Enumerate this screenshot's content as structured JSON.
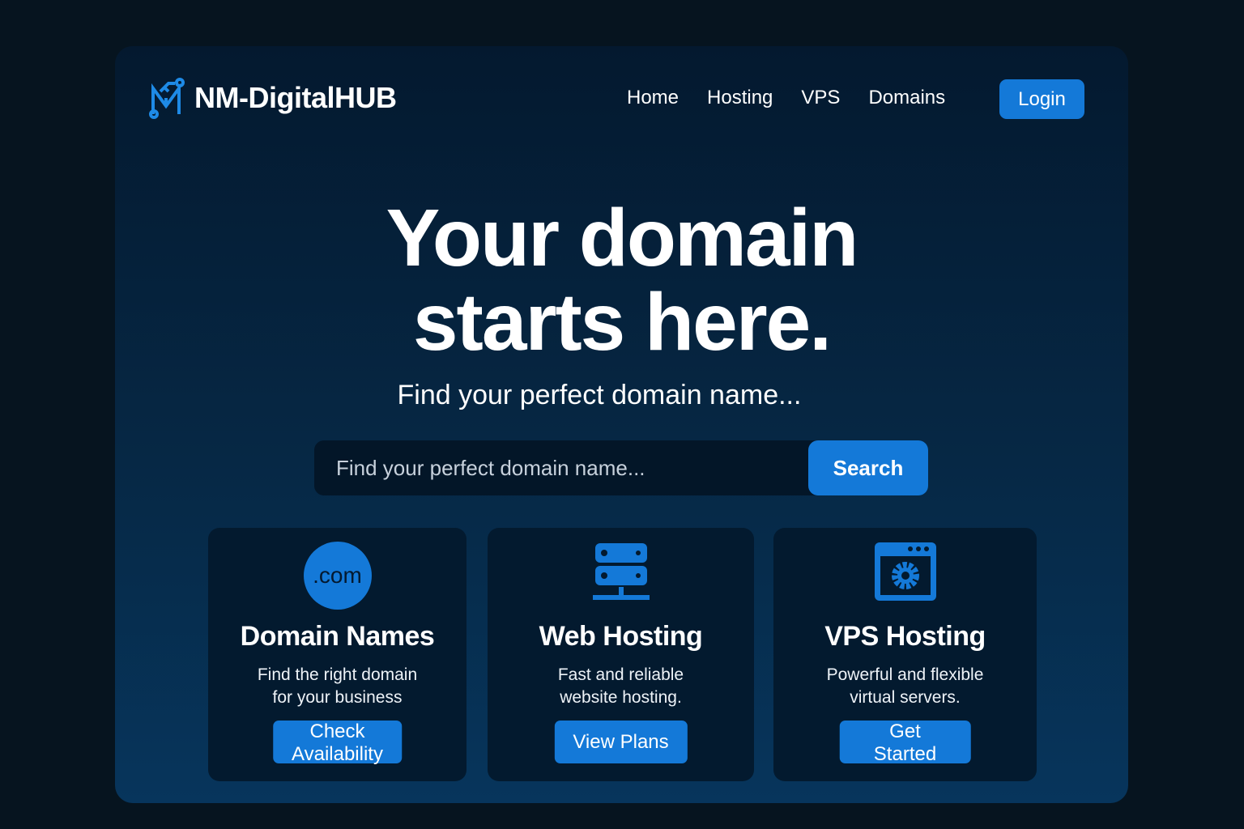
{
  "brand": {
    "name": "NM-DigitalHUB",
    "accent": "#1479d8"
  },
  "nav": {
    "items": [
      "Home",
      "Hosting",
      "VPS",
      "Domains"
    ],
    "login": "Login"
  },
  "hero": {
    "line1": "Your domain",
    "line2": "starts here.",
    "subtitle": "Find your perfect domain name..."
  },
  "search": {
    "placeholder": "Find your perfect domain name...",
    "button": "Search"
  },
  "cards": [
    {
      "icon": "dot-com-icon",
      "icon_text": ".com",
      "title": "Domain Names",
      "desc1": "Find the right domain",
      "desc2": "for your business",
      "button": "Check Availability"
    },
    {
      "icon": "server-icon",
      "title": "Web Hosting",
      "desc1": "Fast and reliable",
      "desc2": "website hosting.",
      "button": "View Plans"
    },
    {
      "icon": "browser-gear-icon",
      "title": "VPS Hosting",
      "desc1": "Powerful and flexible",
      "desc2": "virtual servers.",
      "button": "Get Started"
    }
  ]
}
